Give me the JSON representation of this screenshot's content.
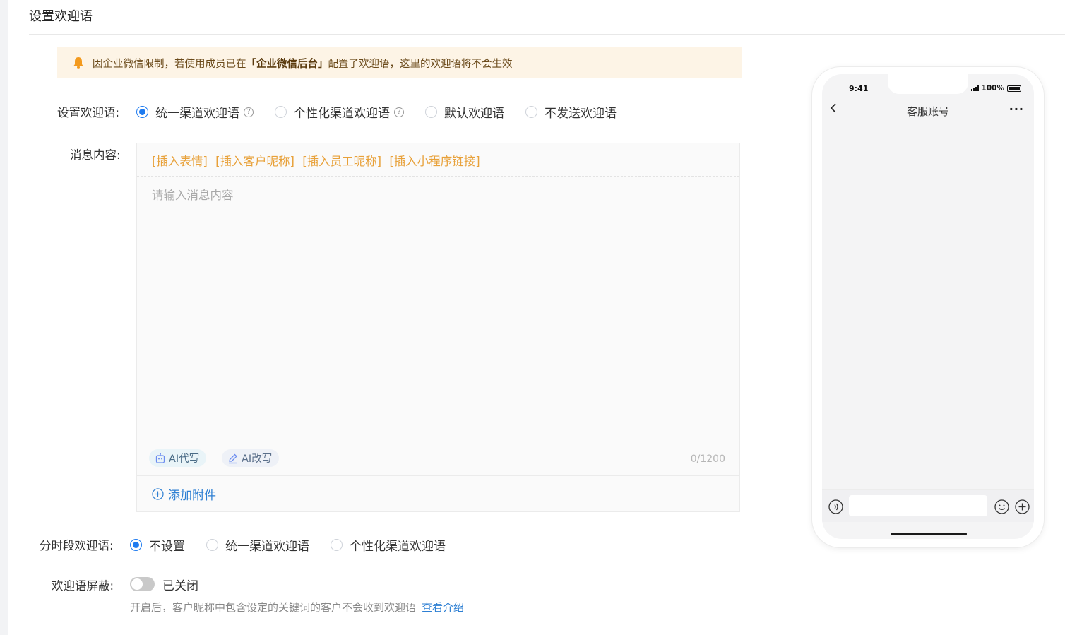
{
  "section_title": "设置欢迎语",
  "notice": {
    "prefix": "因企业微信限制，若使用成员已在",
    "highlight": "「企业微信后台」",
    "suffix": "配置了欢迎语，这里的欢迎语将不会生效",
    "icon": "bell-icon",
    "color": "#f39a1e"
  },
  "welcome_setting": {
    "label": "设置欢迎语:",
    "options": [
      {
        "label": "统一渠道欢迎语",
        "selected": true,
        "help": true
      },
      {
        "label": "个性化渠道欢迎语",
        "selected": false,
        "help": true
      },
      {
        "label": "默认欢迎语",
        "selected": false,
        "help": false
      },
      {
        "label": "不发送欢迎语",
        "selected": false,
        "help": false
      }
    ]
  },
  "message": {
    "label": "消息内容:",
    "inserts": [
      "[插入表情]",
      "[插入客户昵称]",
      "[插入员工昵称]",
      "[插入小程序链接]"
    ],
    "placeholder": "请输入消息内容",
    "ai_write": "AI代写",
    "ai_rewrite": "AI改写",
    "counter": "0/1200",
    "attach": "添加附件"
  },
  "timed_welcome": {
    "label": "分时段欢迎语:",
    "options": [
      {
        "label": "不设置",
        "selected": true
      },
      {
        "label": "统一渠道欢迎语",
        "selected": false
      },
      {
        "label": "个性化渠道欢迎语",
        "selected": false
      }
    ]
  },
  "shield": {
    "label": "欢迎语屏蔽:",
    "state": "已关闭",
    "enabled": false,
    "hint": "开启后，客户昵称中包含设定的关键词的客户不会收到欢迎语",
    "link": "查看介绍"
  },
  "phone": {
    "time": "9:41",
    "battery": "100%",
    "title": "客服账号",
    "more": "···"
  },
  "colors": {
    "accent": "#1e7bf0",
    "insert_orange": "#e8a13a",
    "link_blue": "#2d7fd3",
    "notice_bg": "#fdf4e6"
  }
}
